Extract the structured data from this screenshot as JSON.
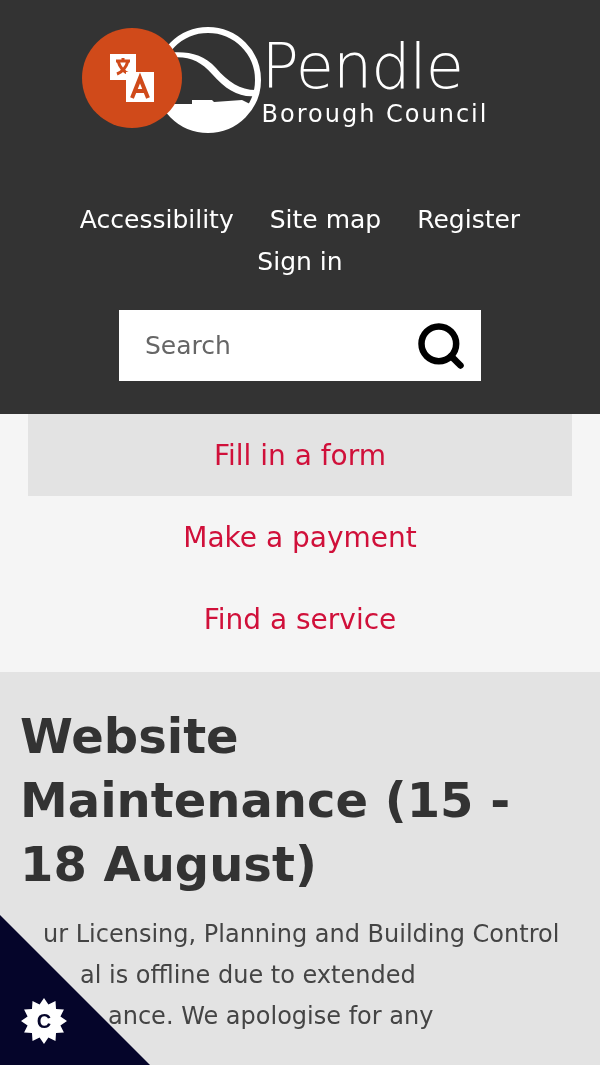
{
  "header": {
    "logo": {
      "name": "Pendle",
      "subtitle": "Borough Council"
    },
    "nav_links": [
      {
        "label": "Accessibility"
      },
      {
        "label": "Site map"
      },
      {
        "label": "Register"
      },
      {
        "label": "Sign in"
      }
    ],
    "search": {
      "placeholder": "Search"
    }
  },
  "quick_links": [
    {
      "label": "Fill in a form",
      "selected": true
    },
    {
      "label": "Make a payment",
      "selected": false
    },
    {
      "label": "Find a service",
      "selected": false
    }
  ],
  "notice": {
    "title": "Website Maintenance (15 - 18 August)",
    "body_lines": [
      "ur Licensing, Planning and Building Control",
      "al is offline due to extended",
      "ance. We apologise for any"
    ]
  },
  "cookie_badge": {
    "label": "C"
  }
}
